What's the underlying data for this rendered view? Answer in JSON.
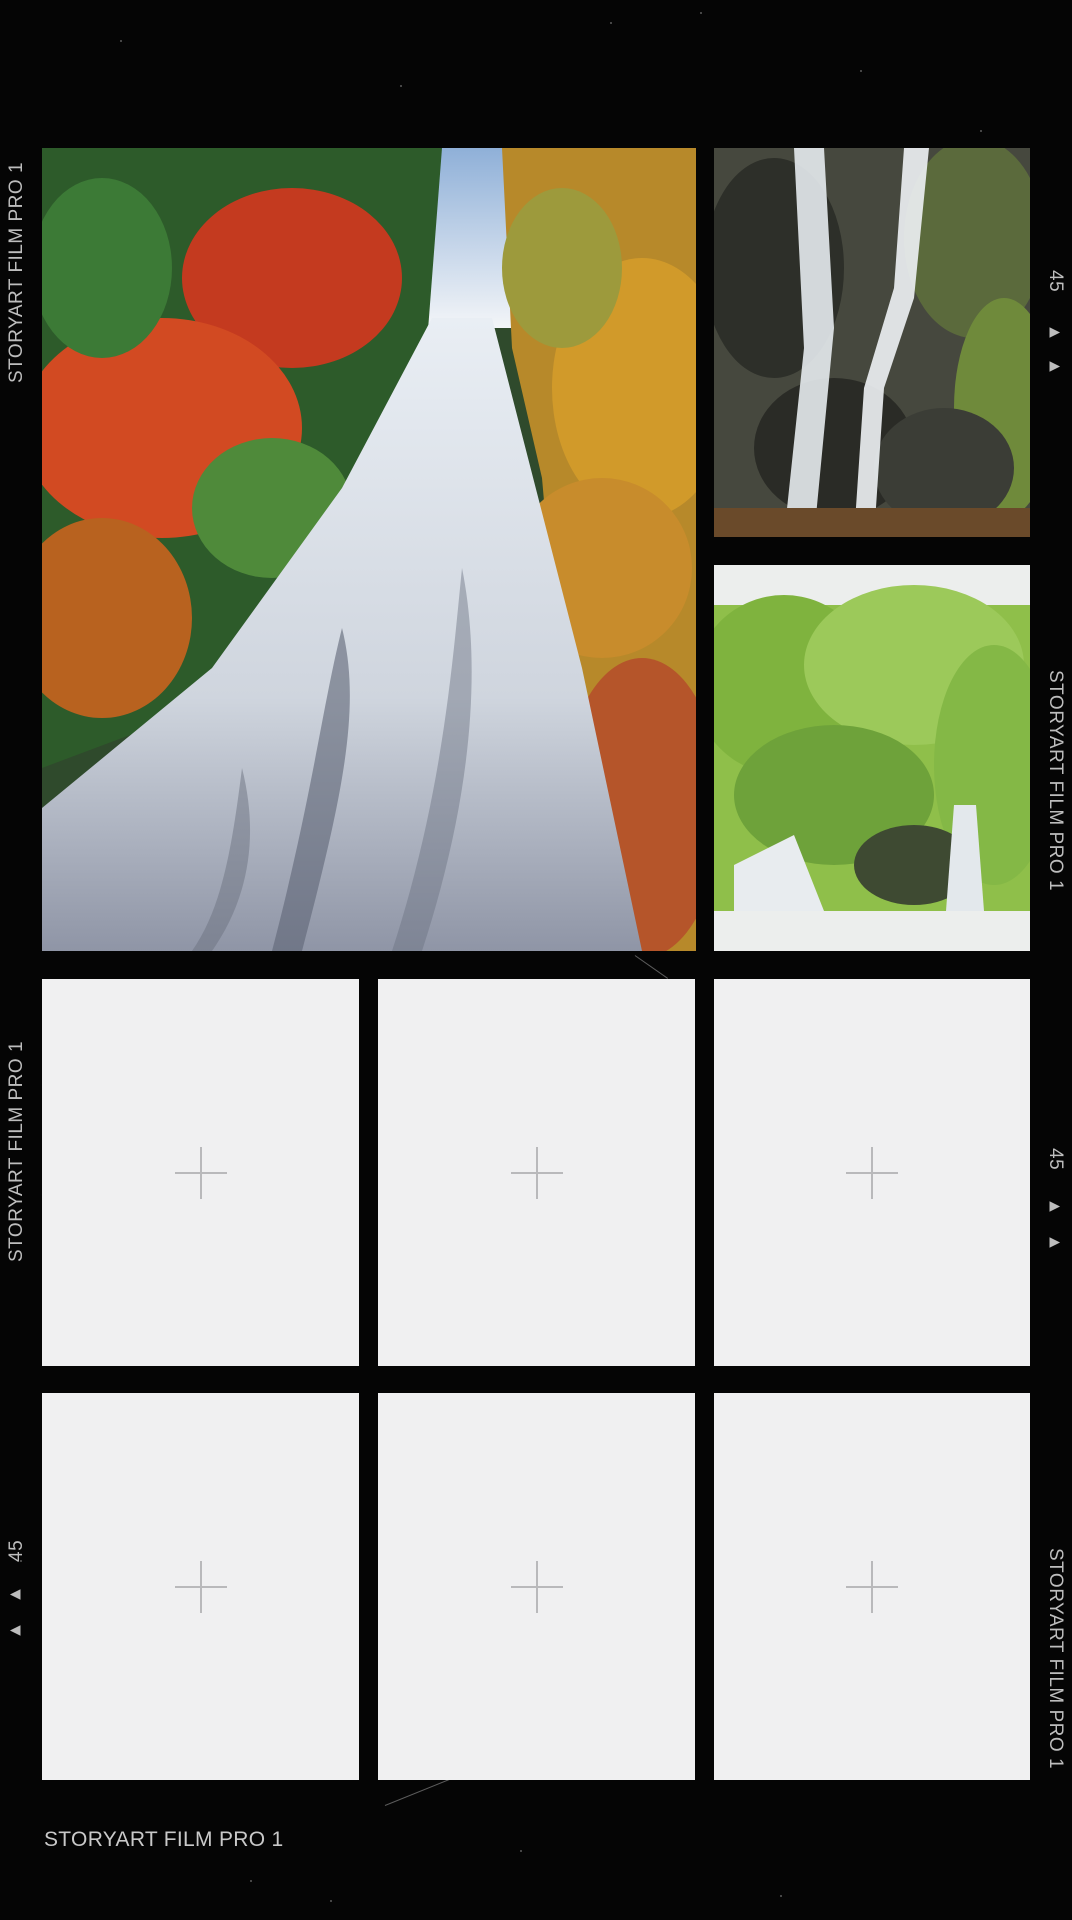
{
  "film_label": "STORYART FILM PRO 1",
  "frame_number": "45",
  "marker_glyph": "▲",
  "slots": [
    {
      "state": "photo",
      "description_icon": "waterfall-autumn-photo"
    },
    {
      "state": "photo",
      "description_icon": "waterfall-rocks-photo"
    },
    {
      "state": "photo",
      "description_icon": "waterfall-green-forest-photo"
    },
    {
      "state": "empty",
      "add_icon": "plus-icon"
    },
    {
      "state": "empty",
      "add_icon": "plus-icon"
    },
    {
      "state": "empty",
      "add_icon": "plus-icon"
    },
    {
      "state": "empty",
      "add_icon": "plus-icon"
    },
    {
      "state": "empty",
      "add_icon": "plus-icon"
    },
    {
      "state": "empty",
      "add_icon": "plus-icon"
    }
  ],
  "colors": {
    "background": "#050505",
    "slot_empty": "#f0f0f1",
    "plus": "#b9b9bb",
    "edge_text": "#bdbdbd"
  }
}
